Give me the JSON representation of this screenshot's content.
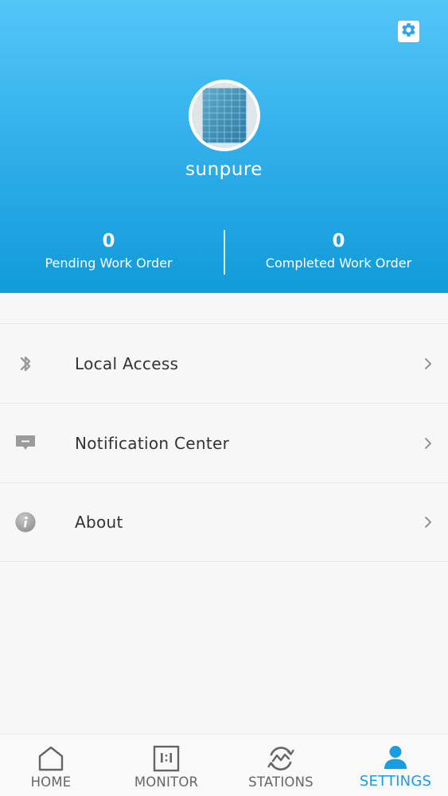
{
  "profile": {
    "username": "sunpure",
    "settings_icon": "gear-icon",
    "avatar_icon": "solar-panel-avatar"
  },
  "stats": {
    "pending": {
      "value": "0",
      "label": "Pending Work Order"
    },
    "completed": {
      "value": "0",
      "label": "Completed Work Order"
    }
  },
  "menu": {
    "items": [
      {
        "label": "Local Access",
        "icon": "bluetooth-icon"
      },
      {
        "label": "Notification Center",
        "icon": "message-icon"
      },
      {
        "label": "About",
        "icon": "info-icon"
      }
    ]
  },
  "tabs": [
    {
      "label": "HOME",
      "icon": "home-icon",
      "active": false
    },
    {
      "label": "MONITOR",
      "icon": "monitor-icon",
      "active": false
    },
    {
      "label": "STATIONS",
      "icon": "stations-icon",
      "active": false
    },
    {
      "label": "SETTINGS",
      "icon": "user-icon",
      "active": true
    }
  ],
  "colors": {
    "header_top": "#54c6f7",
    "header_bottom": "#109bd9",
    "accent": "#1a9ce0",
    "icon_gray": "#9b9b9b"
  }
}
